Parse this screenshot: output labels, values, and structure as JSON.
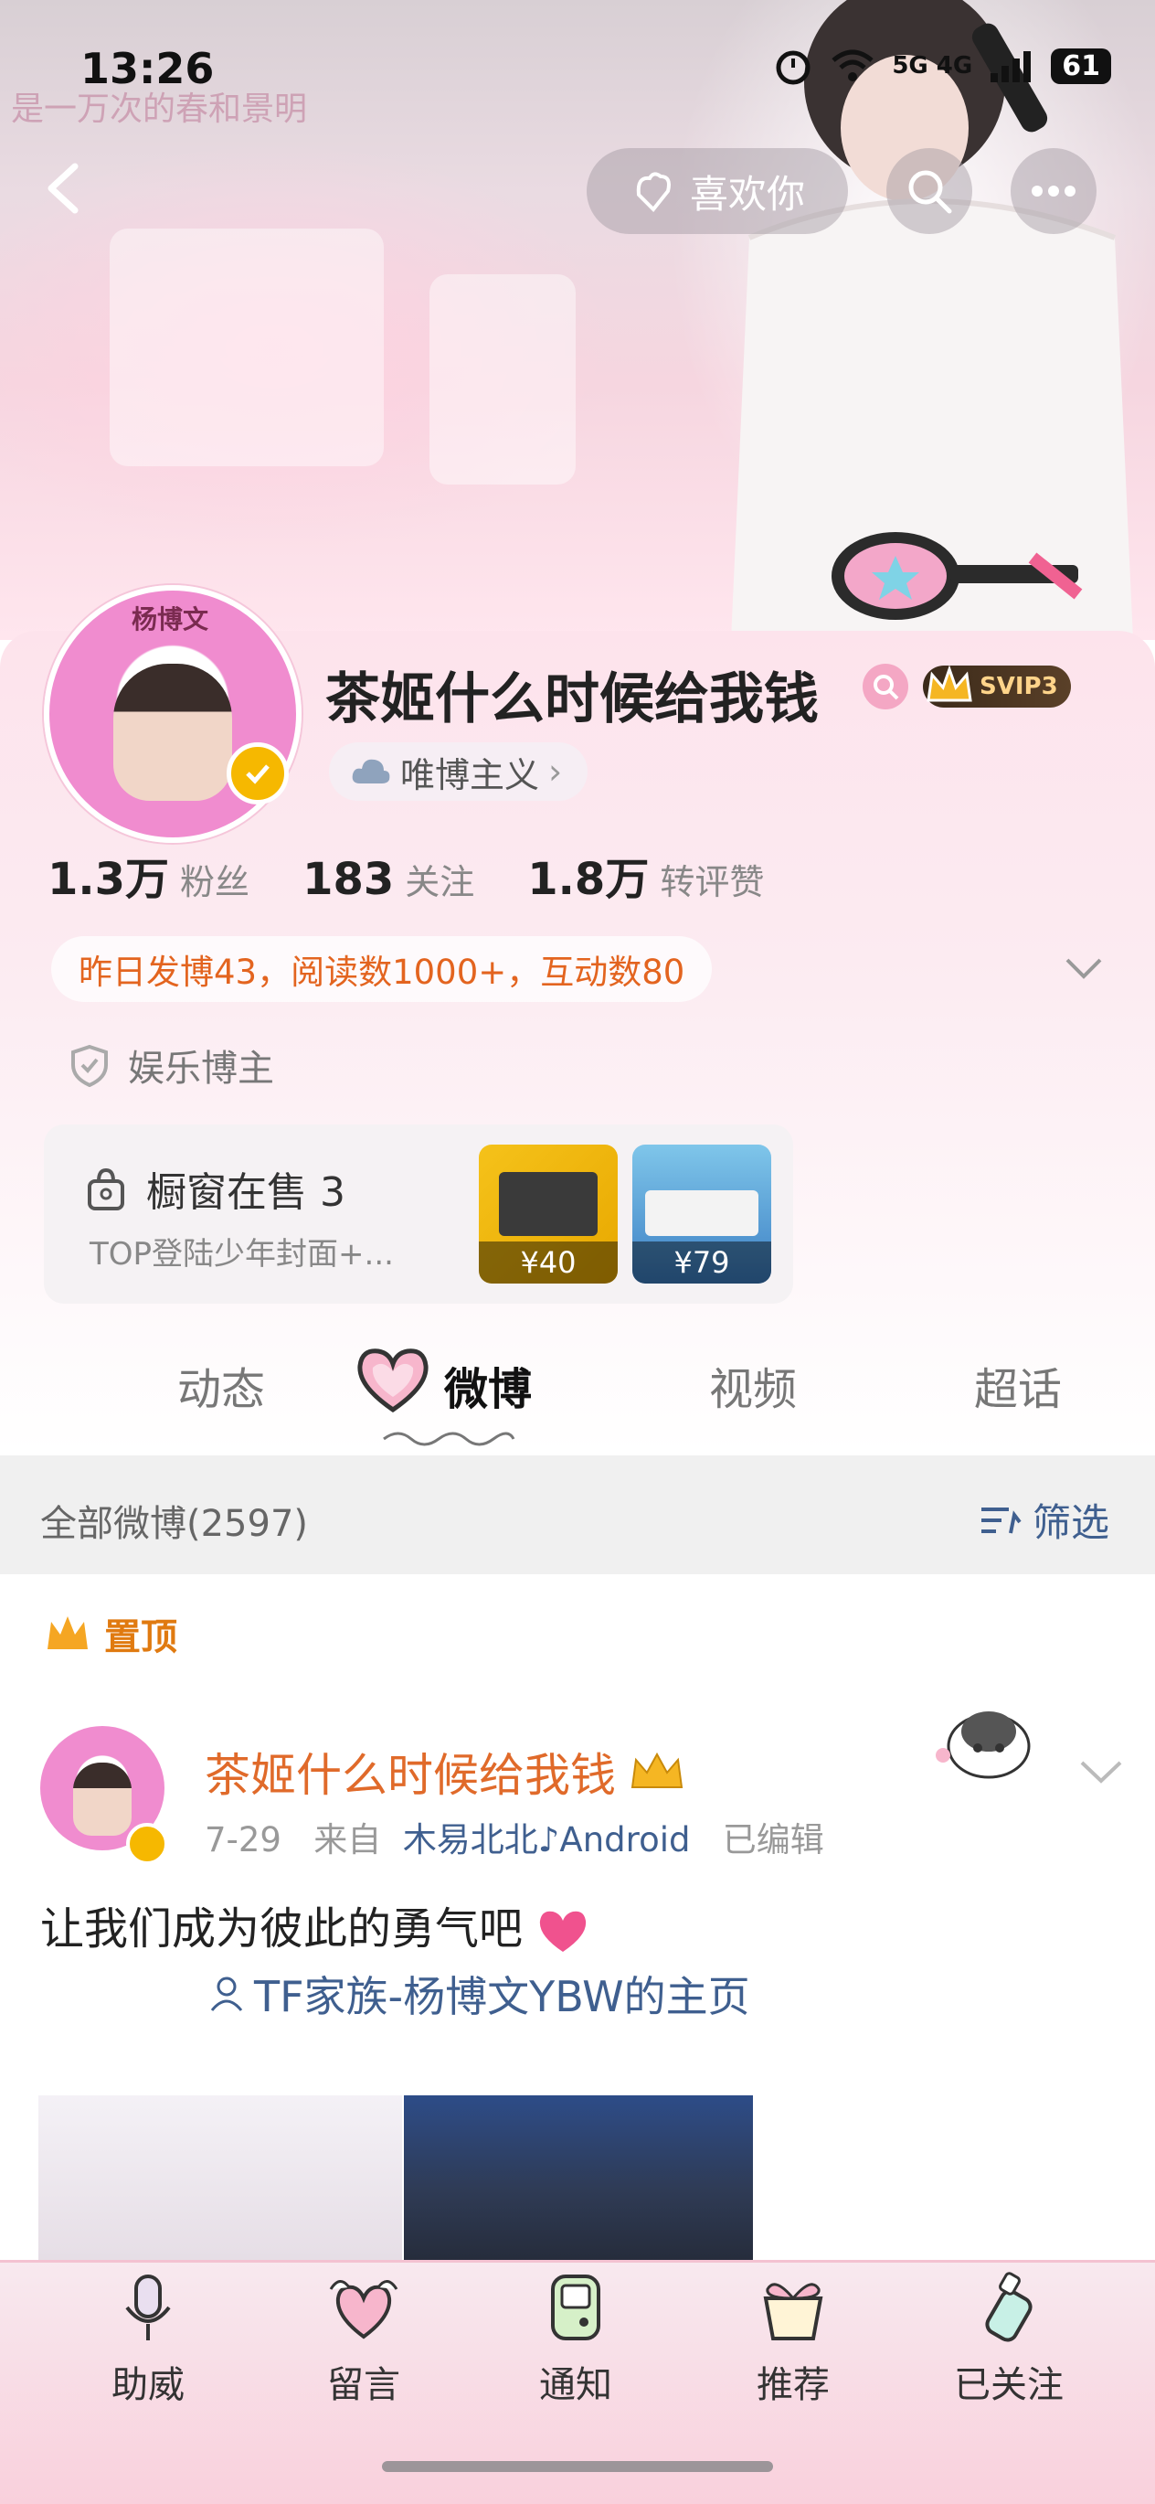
{
  "status_bar": {
    "time": "13:26",
    "network": "5G 4G",
    "battery": "61"
  },
  "header": {
    "like_label": "喜欢你",
    "banner_text": "是一万次的春和景明"
  },
  "profile": {
    "nickname": "茶姬什么时候给我钱",
    "avatar_caption": "杨博文",
    "svip": "SVIP3",
    "tag": "唯博主义",
    "stats": [
      {
        "num": "1.3万",
        "label": "粉丝"
      },
      {
        "num": "183",
        "label": "关注"
      },
      {
        "num": "1.8万",
        "label": "转评赞"
      }
    ],
    "activity": "昨日发博43，阅读数1000+，互动数80",
    "category": "娱乐博主",
    "shop": {
      "title": "橱窗在售 3",
      "subtitle": "TOP登陆少年封面+...",
      "prices": [
        "¥40",
        "¥79"
      ]
    }
  },
  "tabs": [
    "动态",
    "微博",
    "视频",
    "超话"
  ],
  "active_tab": "微博",
  "filter": {
    "left": "全部微博(2597)",
    "right": "筛选"
  },
  "pinned_label": "置顶",
  "post": {
    "author": "茶姬什么时候给我钱",
    "date": "7-29",
    "from_prefix": "来自",
    "source": "木易北北♪Android",
    "edited": "已编辑",
    "text": "让我们成为彼此的勇气吧",
    "link": "TF家族-杨博文YBW的主页"
  },
  "bottom_nav": [
    "助威",
    "留言",
    "通知",
    "推荐",
    "已关注"
  ],
  "colors": {
    "accent_orange": "#e06a2a",
    "link_blue": "#3f5f8f",
    "badge_gold": "#f6b800"
  }
}
